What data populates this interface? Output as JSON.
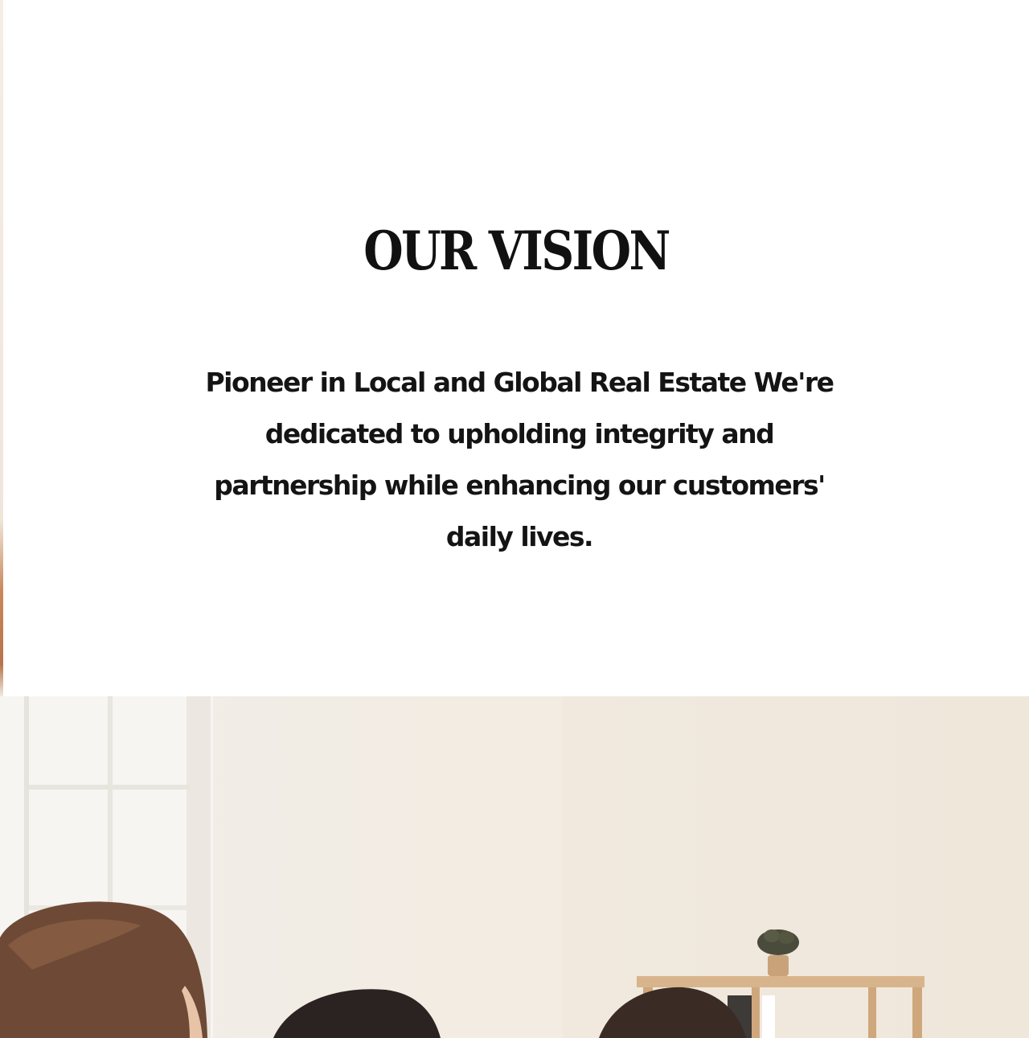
{
  "vision": {
    "title": "OUR VISION",
    "text": "Pioneer in Local and Global Real Estate We're dedicated to upholding integrity and partnership while enhancing our customers' daily lives."
  },
  "photo": {
    "subject": "team-photo"
  }
}
